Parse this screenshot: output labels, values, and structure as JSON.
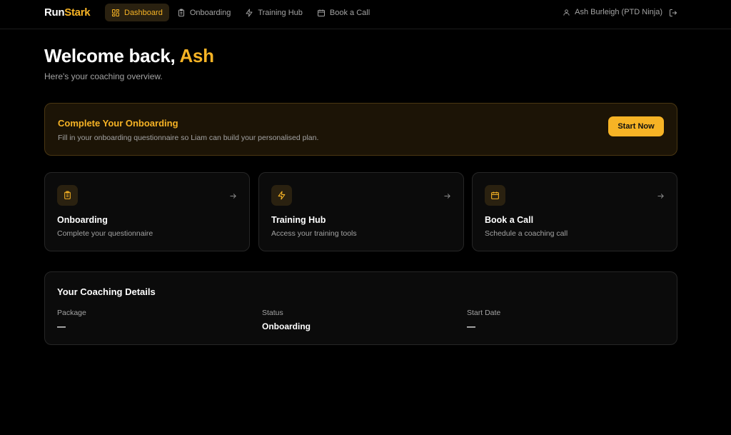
{
  "brand": {
    "part1": "Run",
    "part2": "Stark"
  },
  "nav": {
    "items": [
      {
        "label": "Dashboard",
        "icon": "grid-icon",
        "active": true
      },
      {
        "label": "Onboarding",
        "icon": "clipboard-icon",
        "active": false
      },
      {
        "label": "Training Hub",
        "icon": "lightning-icon",
        "active": false
      },
      {
        "label": "Book a Call",
        "icon": "calendar-icon",
        "active": false
      }
    ]
  },
  "user": {
    "name": "Ash Burleigh (PTD Ninja)",
    "icon": "user-icon",
    "logout_icon": "logout-icon"
  },
  "welcome": {
    "prefix": "Welcome back, ",
    "name": "Ash",
    "subtitle": "Here's your coaching overview."
  },
  "banner": {
    "title": "Complete Your Onboarding",
    "description": "Fill in your onboarding questionnaire so Liam can build your personalised plan.",
    "button_label": "Start Now"
  },
  "cards": [
    {
      "title": "Onboarding",
      "description": "Complete your questionnaire",
      "icon": "clipboard-icon"
    },
    {
      "title": "Training Hub",
      "description": "Access your training tools",
      "icon": "lightning-icon"
    },
    {
      "title": "Book a Call",
      "description": "Schedule a coaching call",
      "icon": "calendar-icon"
    }
  ],
  "details": {
    "title": "Your Coaching Details",
    "fields": [
      {
        "label": "Package",
        "value": "—"
      },
      {
        "label": "Status",
        "value": "Onboarding"
      },
      {
        "label": "Start Date",
        "value": "—"
      }
    ]
  },
  "colors": {
    "accent": "#f6b325",
    "background": "#000000",
    "muted": "#a3a3a3"
  }
}
